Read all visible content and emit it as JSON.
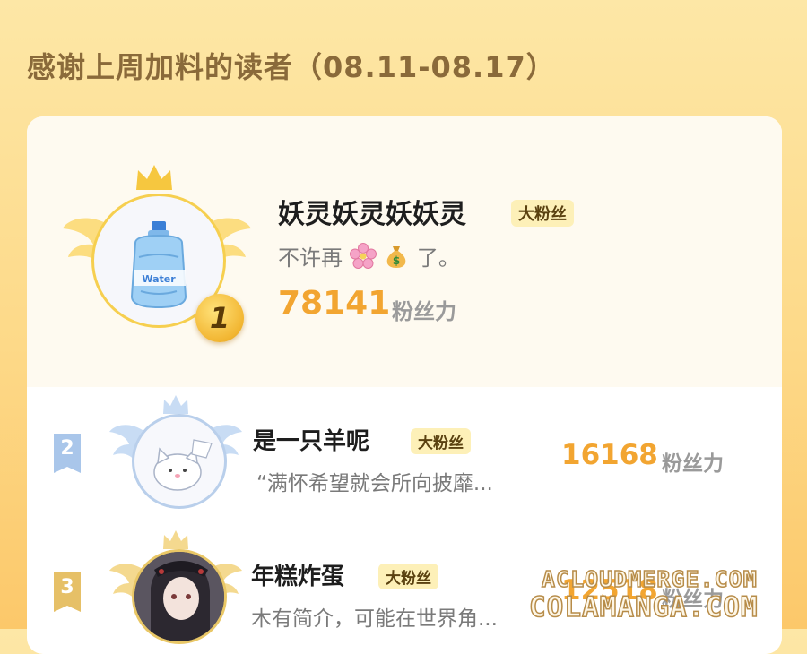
{
  "page": {
    "title": "感谢上周加料的读者（08.11-08.17）"
  },
  "entries": [
    {
      "rank": "1",
      "name": "妖灵妖灵妖妖灵",
      "badge": "大粉丝",
      "desc_prefix": "不许再",
      "desc_suffix": "了。",
      "desc_emojis": [
        "cherry-blossom-icon",
        "money-bag-icon"
      ],
      "score": "78141",
      "unit": "粉丝力"
    },
    {
      "rank": "2",
      "name": "是一只羊呢",
      "badge": "大粉丝",
      "desc": "“满怀希望就会所向披靡...",
      "score": "16168",
      "unit": "粉丝力"
    },
    {
      "rank": "3",
      "name": "年糕炸蛋",
      "badge": "大粉丝",
      "desc": "木有简介，可能在世界角...",
      "score": "12518",
      "unit": "粉丝力"
    }
  ],
  "watermark": {
    "line1": "ACLOUDMERGE.COM",
    "line2": "COLAMANGA.COM"
  },
  "colors": {
    "score": "#f2a531",
    "badge_bg": "#fdf0b8",
    "rank2": "#a9c6ea",
    "rank3": "#e6c067"
  }
}
